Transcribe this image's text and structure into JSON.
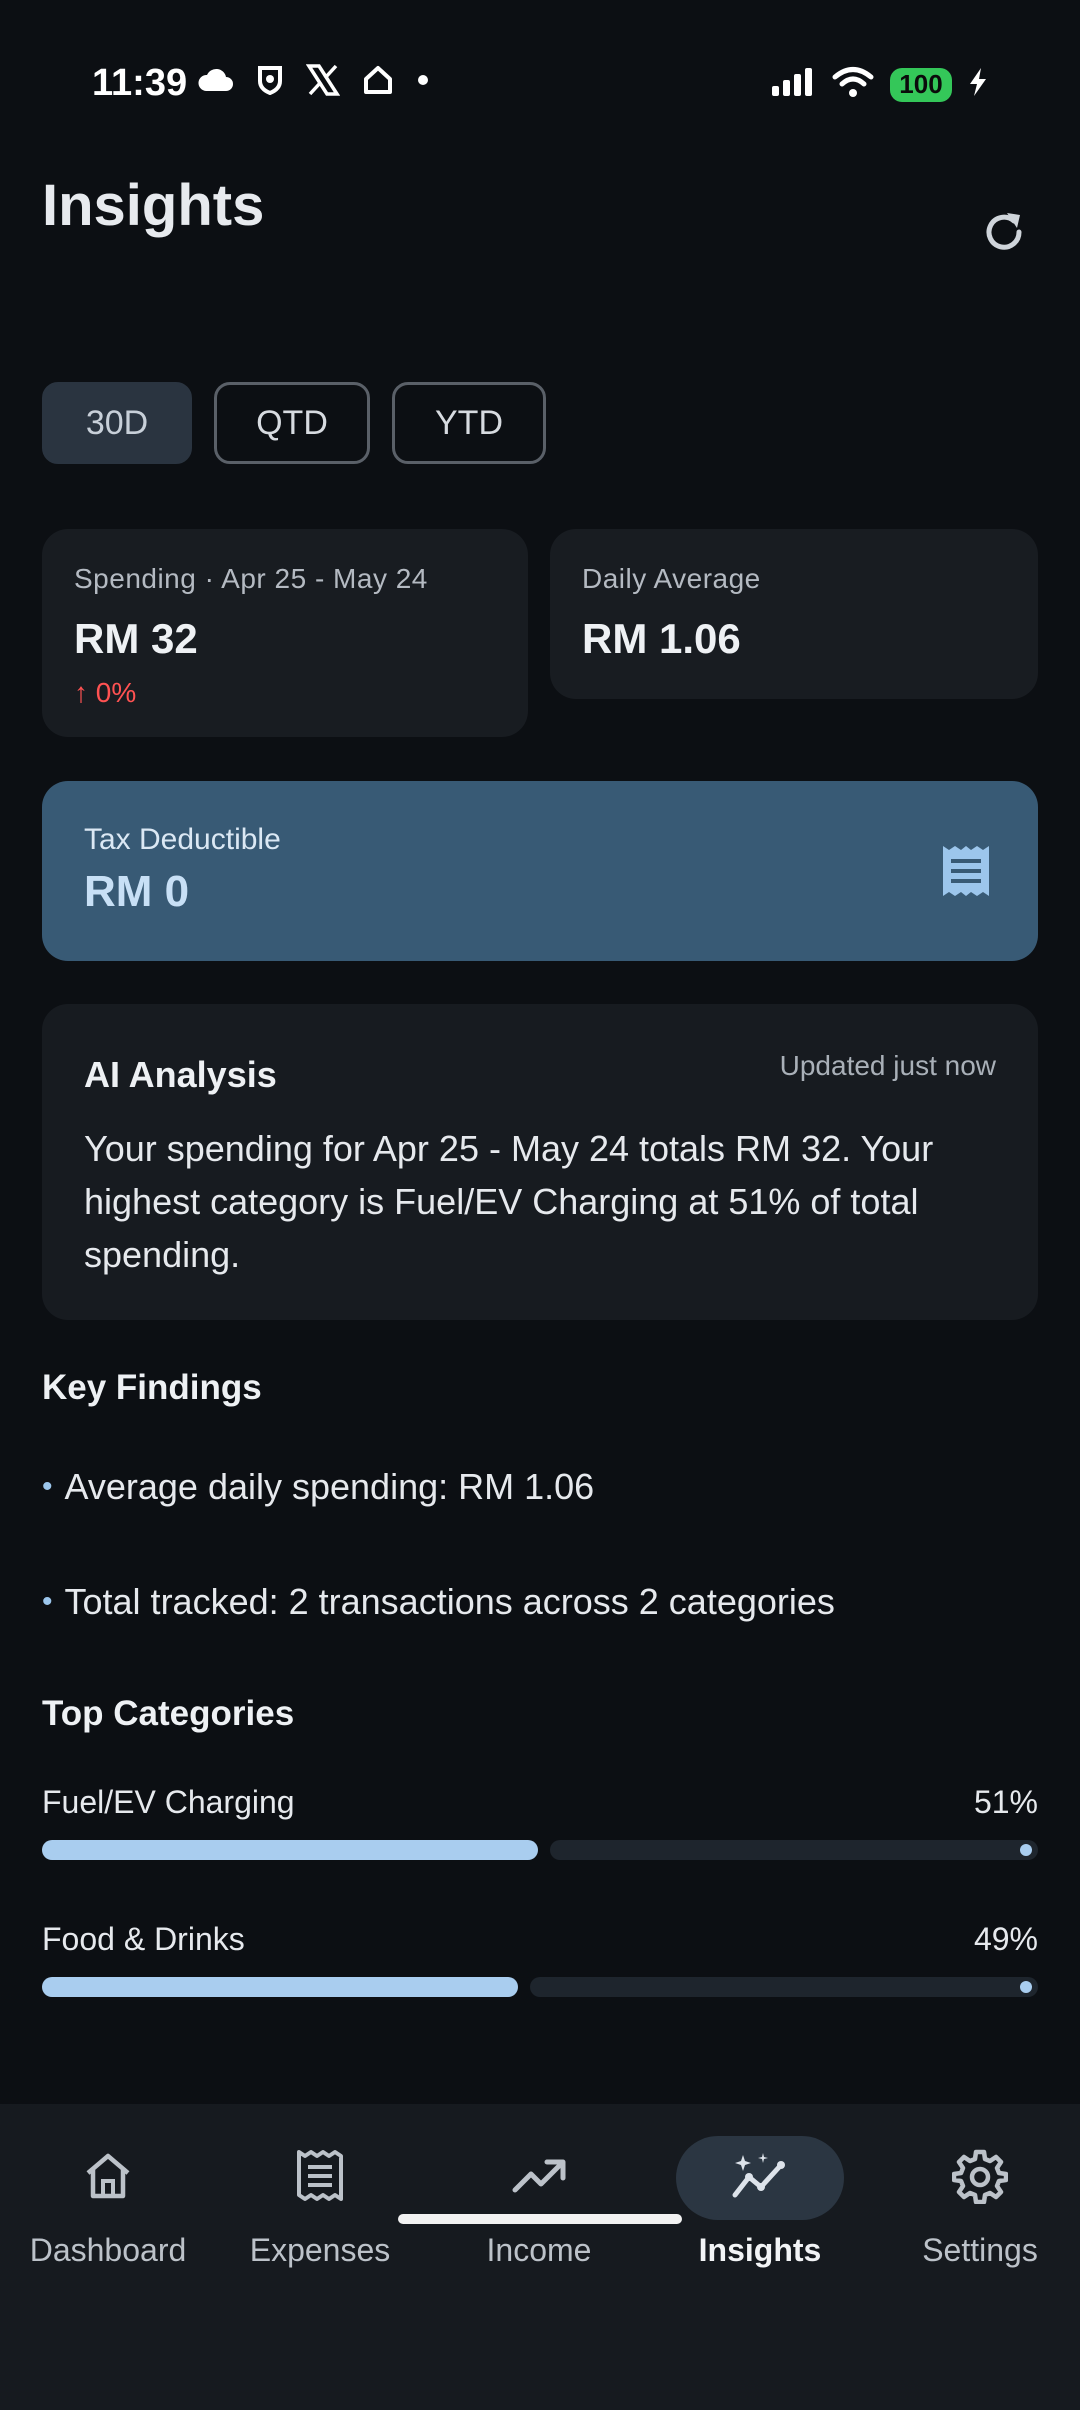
{
  "status_bar": {
    "time": "11:39",
    "left_icons": [
      "cloud-icon",
      "shield-badge-icon",
      "x-logo-icon",
      "home-outline-icon",
      "dot-icon"
    ],
    "right_icons": [
      "signal-icon",
      "wifi-icon",
      "battery-icon",
      "charging-bolt-icon"
    ],
    "battery_level": "100",
    "battery_color": "#34c759"
  },
  "header": {
    "title": "Insights",
    "refresh_icon": "refresh-icon"
  },
  "period_tabs": [
    {
      "label": "30D",
      "selected": true
    },
    {
      "label": "QTD",
      "selected": false
    },
    {
      "label": "YTD",
      "selected": false
    }
  ],
  "spending_card": {
    "label": "Spending · Apr 25 - May 24",
    "value": "RM 32",
    "delta": "↑ 0%",
    "delta_color": "#ff5252"
  },
  "daily_average_card": {
    "label": "Daily Average",
    "value": "RM 1.06"
  },
  "tax_card": {
    "label": "Tax Deductible",
    "value": "RM 0",
    "icon": "receipt-icon",
    "background": "#385a75"
  },
  "ai_analysis": {
    "title": "AI Analysis",
    "updated": "Updated just now",
    "text": "Your spending for Apr 25 - May 24 totals RM 32. Your highest category is Fuel/EV Charging at 51% of total spending."
  },
  "key_findings": {
    "title": "Key Findings",
    "items": [
      "Average daily spending: RM 1.06",
      "Total tracked: 2 transactions across 2 categories"
    ]
  },
  "top_categories": {
    "title": "Top Categories",
    "items": [
      {
        "name": "Fuel/EV Charging",
        "percent_label": "51%",
        "percent": 51
      },
      {
        "name": "Food & Drinks",
        "percent_label": "49%",
        "percent": 49
      }
    ],
    "bar_color": "#a9cdef"
  },
  "bottom_nav": {
    "items": [
      {
        "label": "Dashboard",
        "icon": "home-icon",
        "active": false
      },
      {
        "label": "Expenses",
        "icon": "receipt-icon",
        "active": false
      },
      {
        "label": "Income",
        "icon": "trending-up-icon",
        "active": false
      },
      {
        "label": "Insights",
        "icon": "insights-icon",
        "active": true
      },
      {
        "label": "Settings",
        "icon": "gear-icon",
        "active": false
      }
    ]
  }
}
